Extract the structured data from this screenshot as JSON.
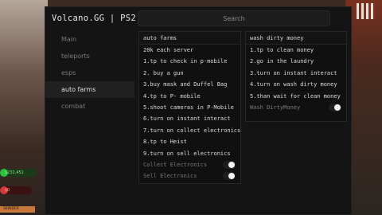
{
  "app": {
    "title": "Volcano.GG | PS2!"
  },
  "search": {
    "placeholder": "Search"
  },
  "nav": {
    "items": [
      "Main",
      "teleports",
      "esps",
      "auto farms",
      "combat"
    ],
    "active": "auto farms"
  },
  "auto_farms": {
    "header": "auto farms",
    "steps": [
      "20k each server",
      "1.tp to check in p-mobile",
      "2. buy a gun",
      "3.buy mask and Duffel Bag",
      "4.tp to P- mobile",
      "5.shoot cameras in P-Mobile",
      "6.turn on instant interact",
      "7.turn on collect electronics",
      "8.tp to Heist",
      "9.turn on sell electronics"
    ],
    "toggles": [
      {
        "label": "Collect Electronics",
        "on": false
      },
      {
        "label": "Sell Electronics",
        "on": false
      }
    ]
  },
  "wash": {
    "header": "wash dirty money",
    "steps": [
      "1.tp to clean money",
      "2.go in the laundry",
      "3.turn on instant interact",
      "4.turn on wash dirty money",
      "5.than wait for clean money"
    ],
    "toggles": [
      {
        "label": "Wash DirtyMoney",
        "on": false
      }
    ]
  },
  "hud": {
    "cash": "$232,451",
    "bank": "$0",
    "job": "SKINDER"
  },
  "colors": {
    "accent_cash": "#2fbf3f",
    "accent_bank": "#d23a3a",
    "accent_job": "#c8783a"
  }
}
